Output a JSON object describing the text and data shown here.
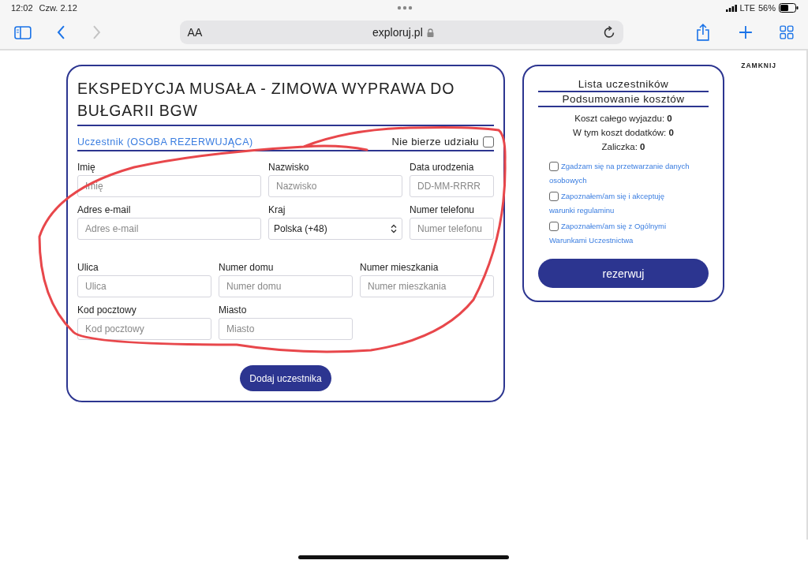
{
  "status_bar": {
    "time": "12:02",
    "date": "Czw. 2.12",
    "network": "LTE",
    "battery": "56%"
  },
  "browser": {
    "text_size": "AA",
    "url": "exploruj.pl"
  },
  "close_link": "ZAMKNIJ",
  "form": {
    "title": "EKSPEDYCJA MUSAŁA - ZIMOWA WYPRAWA DO BUŁGARII BGW",
    "section_title": "Uczestnik (OSOBA REZERWUJĄCA)",
    "opt_out": {
      "label": "Nie bierze udziału",
      "checked": false
    },
    "rows": [
      {
        "fields": [
          {
            "kind": "input",
            "label": "Imię",
            "placeholder": "Imię"
          },
          {
            "kind": "input",
            "label": "Nazwisko",
            "placeholder": "Nazwisko"
          },
          {
            "kind": "input",
            "label": "Data urodzenia",
            "placeholder": "DD-MM-RRRR"
          }
        ]
      },
      {
        "fields": [
          {
            "kind": "input",
            "label": "Adres e-mail",
            "placeholder": "Adres e-mail"
          },
          {
            "kind": "select",
            "label": "Kraj",
            "value": "Polska (+48)"
          },
          {
            "kind": "input",
            "label": "Numer telefonu",
            "placeholder": "Numer telefonu"
          }
        ]
      },
      {
        "fields": [
          {
            "kind": "input",
            "label": "Ulica",
            "placeholder": "Ulica"
          },
          {
            "kind": "input",
            "label": "Numer domu",
            "placeholder": "Numer domu"
          },
          {
            "kind": "input",
            "label": "Numer mieszkania",
            "placeholder": "Numer mieszkania"
          }
        ]
      },
      {
        "fields": [
          {
            "kind": "input",
            "label": "Kod pocztowy",
            "placeholder": "Kod pocztowy"
          },
          {
            "kind": "input",
            "label": "Miasto",
            "placeholder": "Miasto"
          }
        ]
      }
    ],
    "add_button": "Dodaj uczestnika"
  },
  "summary": {
    "headings": [
      "Lista uczestników",
      "Podsumowanie kosztów"
    ],
    "costs": [
      {
        "label": "Koszt całego wyjazdu:",
        "value": "0"
      },
      {
        "label": "W tym koszt dodatków:",
        "value": "0"
      },
      {
        "label": "Zaliczka:",
        "value": "0"
      }
    ],
    "consents": [
      {
        "text": "Zgadzam się na przetwarzanie danych osobowych",
        "checked": false
      },
      {
        "text": "Zapoznałem/am się i akceptuję warunki regulaminu",
        "checked": false
      },
      {
        "text": "Zapoznałem/am się z Ogólnymi Warunkami Uczestnictwa",
        "checked": false
      }
    ],
    "reserve_button": "rezerwuj"
  }
}
